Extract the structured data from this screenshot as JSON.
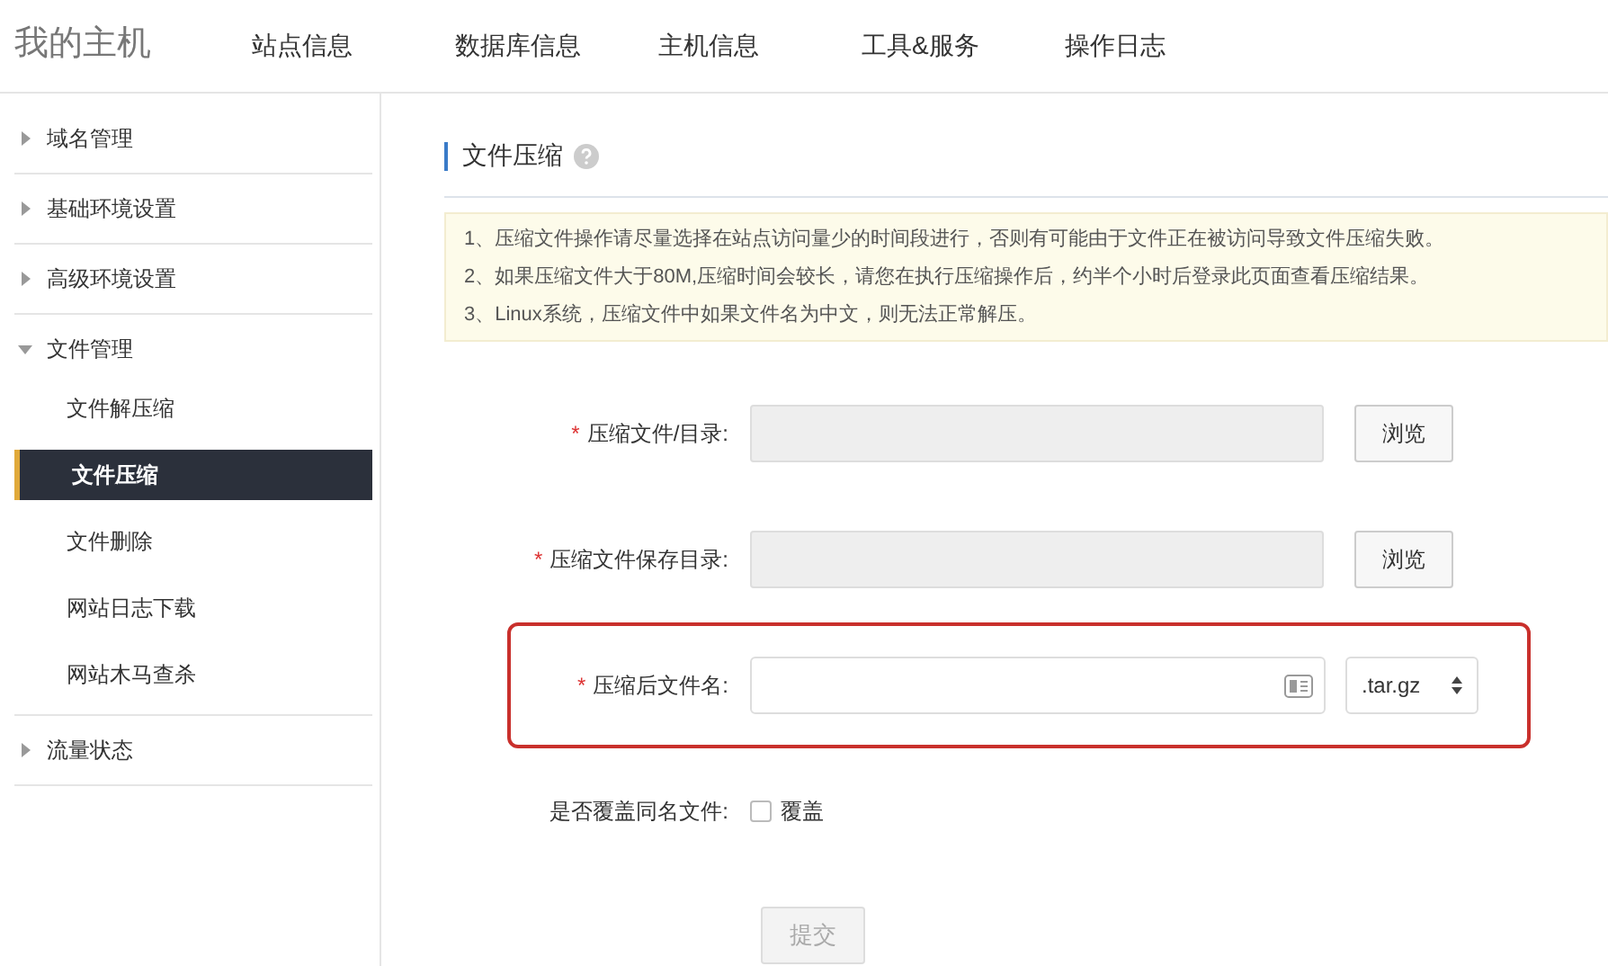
{
  "header": {
    "logo": "我的主机",
    "nav": [
      {
        "label": "站点信息"
      },
      {
        "label": "数据库信息"
      },
      {
        "label": "主机信息"
      },
      {
        "label": "工具&服务"
      },
      {
        "label": "操作日志"
      }
    ]
  },
  "sidebar": {
    "items": [
      {
        "label": "域名管理",
        "expanded": false
      },
      {
        "label": "基础环境设置",
        "expanded": false
      },
      {
        "label": "高级环境设置",
        "expanded": false
      },
      {
        "label": "文件管理",
        "expanded": true,
        "children": [
          {
            "label": "文件解压缩",
            "selected": false
          },
          {
            "label": "文件压缩",
            "selected": true
          },
          {
            "label": "文件删除",
            "selected": false
          },
          {
            "label": "网站日志下载",
            "selected": false
          },
          {
            "label": "网站木马查杀",
            "selected": false
          }
        ]
      },
      {
        "label": "流量状态",
        "expanded": false
      }
    ]
  },
  "main": {
    "title": "文件压缩",
    "notices": [
      "1、压缩文件操作请尽量选择在站点访问量少的时间段进行，否则有可能由于文件正在被访问导致文件压缩失败。",
      "2、如果压缩文件大于80M,压缩时间会较长，请您在执行压缩操作后，约半个小时后登录此页面查看压缩结果。",
      "3、Linux系统，压缩文件中如果文件名为中文，则无法正常解压。"
    ],
    "form": [
      {
        "kind": "browse",
        "label": "压缩文件/目录:",
        "required_mark": "*",
        "disabled": true,
        "highlighted": false,
        "button": "浏览"
      },
      {
        "kind": "browse",
        "label": "压缩文件保存目录:",
        "required_mark": "*",
        "disabled": true,
        "highlighted": false,
        "button": "浏览"
      },
      {
        "kind": "filename",
        "label": "压缩后文件名:",
        "required_mark": "*",
        "disabled": false,
        "highlighted": true,
        "select": ".tar.gz"
      },
      {
        "kind": "checkbox",
        "label": "是否覆盖同名文件:",
        "checked": false,
        "option": "覆盖",
        "highlighted": false
      }
    ],
    "submit": {
      "label": "提交",
      "disabled": true
    }
  }
}
